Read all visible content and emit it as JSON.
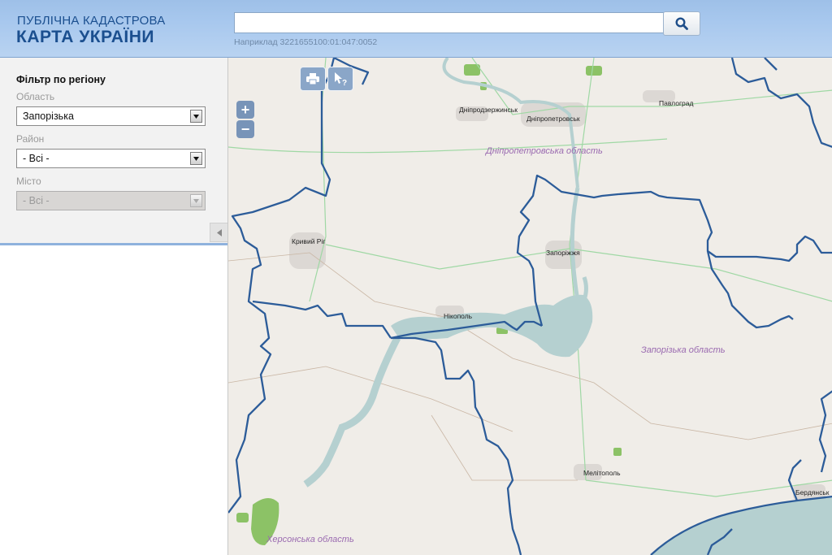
{
  "header": {
    "logo_line1": "ПУБЛІЧНА КАДАСТРОВА",
    "logo_line2": "КАРТА УКРАЇНИ",
    "search_value": "",
    "search_hint": "Наприклад 3221655100:01:047:0052",
    "search_icon": "search-icon"
  },
  "sidebar": {
    "title": "Фільтр по регіону",
    "oblast_label": "Область",
    "oblast_value": "Запорізька",
    "raion_label": "Район",
    "raion_value": "- Всі -",
    "misto_label": "Місто",
    "misto_value": "- Всі -"
  },
  "map": {
    "zoom_in": "+",
    "zoom_out": "−",
    "tools": [
      "print-icon",
      "identify-cursor-icon"
    ],
    "cities": [
      "Дніпродзержинськ",
      "Дніпропетровськ",
      "Павлоград",
      "Кривий Ріг",
      "Запоріжжя",
      "Нікополь",
      "Мелітополь",
      "Бердянськ"
    ],
    "oblasts": [
      "Дніпропетровська область",
      "Запорізька область",
      "Херсонська область"
    ],
    "colors": {
      "border": "#2c5c99",
      "water": "#b5d0d0",
      "green": "#8cc266",
      "road": "#9fd8a4"
    }
  }
}
